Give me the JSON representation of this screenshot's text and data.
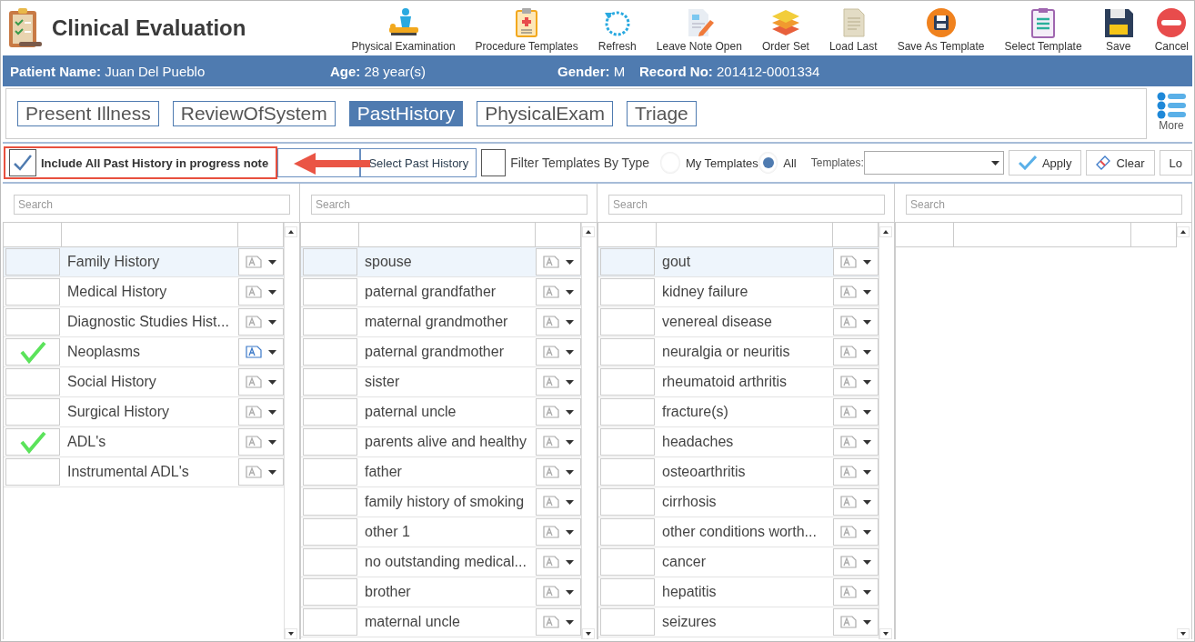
{
  "window": {
    "title": "Clinical Evaluation"
  },
  "toolbar": [
    {
      "label": "Physical Examination",
      "kind": "exam"
    },
    {
      "label": "Procedure Templates",
      "kind": "clipboard"
    },
    {
      "label": "Refresh",
      "kind": "refresh"
    },
    {
      "label": "Leave Note Open",
      "kind": "note"
    },
    {
      "label": "Order Set",
      "kind": "layers"
    },
    {
      "label": "Load Last",
      "kind": "document"
    },
    {
      "label": "Save As Template",
      "kind": "disk-circle"
    },
    {
      "label": "Select Template",
      "kind": "list-clipboard"
    },
    {
      "label": "Save",
      "kind": "disk"
    },
    {
      "label": "Cancel",
      "kind": "cancel"
    }
  ],
  "patient": [
    {
      "label": "Patient Name:",
      "value": "Juan Del Pueblo"
    },
    {
      "label": "Age:",
      "value": "28 year(s)"
    },
    {
      "label": "Gender:",
      "value": "M"
    },
    {
      "label": "Record No:",
      "value": "201412-0001334"
    }
  ],
  "tabs": [
    {
      "label": "Present Illness",
      "selected": false
    },
    {
      "label": "ReviewOfSystem",
      "selected": false
    },
    {
      "label": "PastHistory",
      "selected": true
    },
    {
      "label": "PhysicalExam",
      "selected": false
    },
    {
      "label": "Triage",
      "selected": false
    }
  ],
  "more": "More",
  "filters": {
    "include": {
      "label": "Include All Past History in progress note",
      "checked": true
    },
    "select_button": "Select Past History",
    "filter_by_type": {
      "label": "Filter Templates By Type",
      "checked": false
    },
    "radios": [
      {
        "label": "My Templates",
        "selected": false
      },
      {
        "label": "All",
        "selected": true
      }
    ],
    "templates_label": "Templates:",
    "buttons": [
      {
        "label": "Apply",
        "kind": "apply"
      },
      {
        "label": "Clear",
        "kind": "clear"
      },
      {
        "label": "Lo",
        "kind": "plain"
      }
    ]
  },
  "panels": [
    {
      "search_placeholder": "Search",
      "rows": [
        {
          "label": "Family History",
          "checked": false,
          "selected": true,
          "note": false
        },
        {
          "label": "Medical History",
          "checked": false,
          "selected": false,
          "note": false
        },
        {
          "label": "Diagnostic Studies Hist...",
          "checked": false,
          "selected": false,
          "note": false
        },
        {
          "label": "Neoplasms",
          "checked": true,
          "selected": false,
          "note": true
        },
        {
          "label": "Social History",
          "checked": false,
          "selected": false,
          "note": false
        },
        {
          "label": "Surgical History",
          "checked": false,
          "selected": false,
          "note": false
        },
        {
          "label": "ADL's",
          "checked": true,
          "selected": false,
          "note": false
        },
        {
          "label": "Instrumental ADL's",
          "checked": false,
          "selected": false,
          "note": false
        }
      ]
    },
    {
      "search_placeholder": "Search",
      "rows": [
        {
          "label": "spouse",
          "checked": false,
          "selected": true,
          "note": false
        },
        {
          "label": "paternal grandfather",
          "checked": false,
          "selected": false,
          "note": false
        },
        {
          "label": "maternal grandmother",
          "checked": false,
          "selected": false,
          "note": false
        },
        {
          "label": "paternal grandmother",
          "checked": false,
          "selected": false,
          "note": false
        },
        {
          "label": "sister",
          "checked": false,
          "selected": false,
          "note": false
        },
        {
          "label": "paternal uncle",
          "checked": false,
          "selected": false,
          "note": false
        },
        {
          "label": "parents alive and healthy",
          "checked": false,
          "selected": false,
          "note": false
        },
        {
          "label": "father",
          "checked": false,
          "selected": false,
          "note": false
        },
        {
          "label": "family history of smoking",
          "checked": false,
          "selected": false,
          "note": false
        },
        {
          "label": "other 1",
          "checked": false,
          "selected": false,
          "note": false
        },
        {
          "label": "no outstanding medical...",
          "checked": false,
          "selected": false,
          "note": false
        },
        {
          "label": "brother",
          "checked": false,
          "selected": false,
          "note": false
        },
        {
          "label": "maternal uncle",
          "checked": false,
          "selected": false,
          "note": false
        }
      ]
    },
    {
      "search_placeholder": "Search",
      "rows": [
        {
          "label": "gout",
          "checked": false,
          "selected": true,
          "note": false
        },
        {
          "label": "kidney failure",
          "checked": false,
          "selected": false,
          "note": false
        },
        {
          "label": "venereal disease",
          "checked": false,
          "selected": false,
          "note": false
        },
        {
          "label": "neuralgia or neuritis",
          "checked": false,
          "selected": false,
          "note": false
        },
        {
          "label": "rheumatoid arthritis",
          "checked": false,
          "selected": false,
          "note": false
        },
        {
          "label": "fracture(s)",
          "checked": false,
          "selected": false,
          "note": false
        },
        {
          "label": "headaches",
          "checked": false,
          "selected": false,
          "note": false
        },
        {
          "label": "osteoarthritis",
          "checked": false,
          "selected": false,
          "note": false
        },
        {
          "label": "cirrhosis",
          "checked": false,
          "selected": false,
          "note": false
        },
        {
          "label": "other conditions worth...",
          "checked": false,
          "selected": false,
          "note": false
        },
        {
          "label": "cancer",
          "checked": false,
          "selected": false,
          "note": false
        },
        {
          "label": "hepatitis",
          "checked": false,
          "selected": false,
          "note": false
        },
        {
          "label": "seizures",
          "checked": false,
          "selected": false,
          "note": false
        }
      ]
    },
    {
      "search_placeholder": "Search"
    }
  ]
}
